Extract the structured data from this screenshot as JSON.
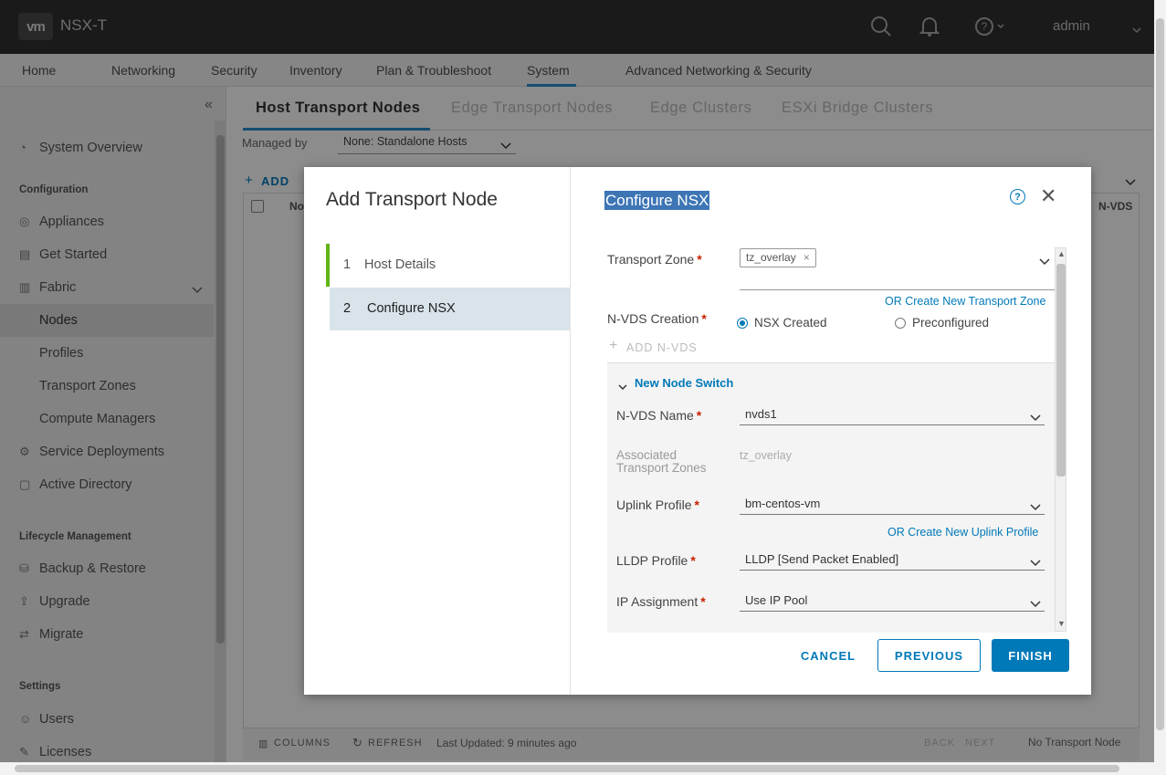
{
  "header": {
    "logo": "vm",
    "app_title": "NSX-T",
    "user": "admin"
  },
  "nav": {
    "items": [
      "Home",
      "Networking",
      "Security",
      "Inventory",
      "Plan & Troubleshoot",
      "System",
      "Advanced Networking & Security"
    ],
    "active": "System"
  },
  "sidebar": {
    "items": {
      "system_overview": "System Overview",
      "configuration": "Configuration",
      "appliances": "Appliances",
      "get_started": "Get Started",
      "fabric": "Fabric",
      "nodes": "Nodes",
      "profiles": "Profiles",
      "transport_zones": "Transport Zones",
      "compute_managers": "Compute Managers",
      "service_deployments": "Service Deployments",
      "active_directory": "Active Directory",
      "lifecycle": "Lifecycle Management",
      "backup_restore": "Backup & Restore",
      "upgrade": "Upgrade",
      "migrate": "Migrate",
      "settings": "Settings",
      "users": "Users",
      "licenses": "Licenses"
    },
    "selected": "Nodes"
  },
  "main": {
    "tabs": [
      "Host Transport Nodes",
      "Edge Transport Nodes",
      "Edge Clusters",
      "ESXi Bridge Clusters"
    ],
    "managed_by_label": "Managed by",
    "managed_by_value": "None: Standalone Hosts",
    "add_label": "ADD",
    "col_partial_left": "No",
    "col_partial_right": "N-VDS",
    "footer": {
      "columns": "COLUMNS",
      "refresh": "REFRESH",
      "last_updated": "Last Updated: 9 minutes ago",
      "back": "BACK",
      "next": "NEXT",
      "status": "No Transport Node"
    }
  },
  "modal": {
    "title": "Add Transport Node",
    "steps": [
      {
        "num": "1",
        "label": "Host Details"
      },
      {
        "num": "2",
        "label": "Configure NSX"
      }
    ],
    "active_step": 2,
    "section_title": "Configure NSX",
    "transport_zone": {
      "label": "Transport Zone",
      "chip": "tz_overlay",
      "create_link": "OR Create New Transport Zone"
    },
    "nvds_creation": {
      "label": "N-VDS Creation",
      "options": [
        "NSX Created",
        "Preconfigured"
      ],
      "selected": "NSX Created"
    },
    "add_nvds": "ADD N-VDS",
    "switch": {
      "header": "New Node Switch",
      "nvds_name": {
        "label": "N-VDS Name",
        "value": "nvds1"
      },
      "assoc_tz": {
        "label": "Associated Transport Zones",
        "value": "tz_overlay"
      },
      "uplink_profile": {
        "label": "Uplink Profile",
        "value": "bm-centos-vm",
        "create_link": "OR Create New Uplink Profile"
      },
      "lldp_profile": {
        "label": "LLDP Profile",
        "value": "LLDP [Send Packet Enabled]"
      },
      "ip_assignment": {
        "label": "IP Assignment",
        "value": "Use IP Pool"
      }
    },
    "buttons": {
      "cancel": "CANCEL",
      "previous": "PREVIOUS",
      "finish": "FINISH"
    }
  }
}
